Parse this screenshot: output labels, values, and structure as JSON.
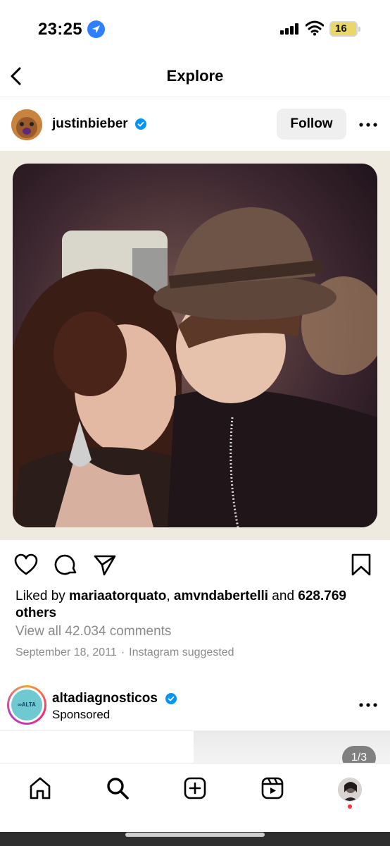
{
  "status_bar": {
    "time": "23:25",
    "battery": "16"
  },
  "header": {
    "title": "Explore"
  },
  "post": {
    "username": "justinbieber",
    "follow_label": "Follow",
    "likes": {
      "prefix": "Liked by ",
      "user1": "mariaatorquato",
      "separator": ", ",
      "user2": "amvndabertelli",
      "and": " and ",
      "others": "628.769 others"
    },
    "comments_link": "View all 42.034 comments",
    "date": "September 18, 2011",
    "dot": "·",
    "suggested": "Instagram suggested"
  },
  "sponsored": {
    "username": "altadiagnosticos",
    "label": "Sponsored",
    "logo_text": "∞ALTA",
    "counter": "1/3"
  },
  "icons": {
    "back": "chevron-left-icon",
    "verified": "verified-badge-icon",
    "more": "more-horizontal-icon",
    "like": "heart-icon",
    "comment": "comment-icon",
    "share": "send-icon",
    "save": "bookmark-icon",
    "tabs": [
      "home-icon",
      "search-icon",
      "create-icon",
      "reels-icon"
    ]
  },
  "colors": {
    "accent": "#0095f6",
    "verified": "#0095f6",
    "notification": "#ff3040"
  }
}
